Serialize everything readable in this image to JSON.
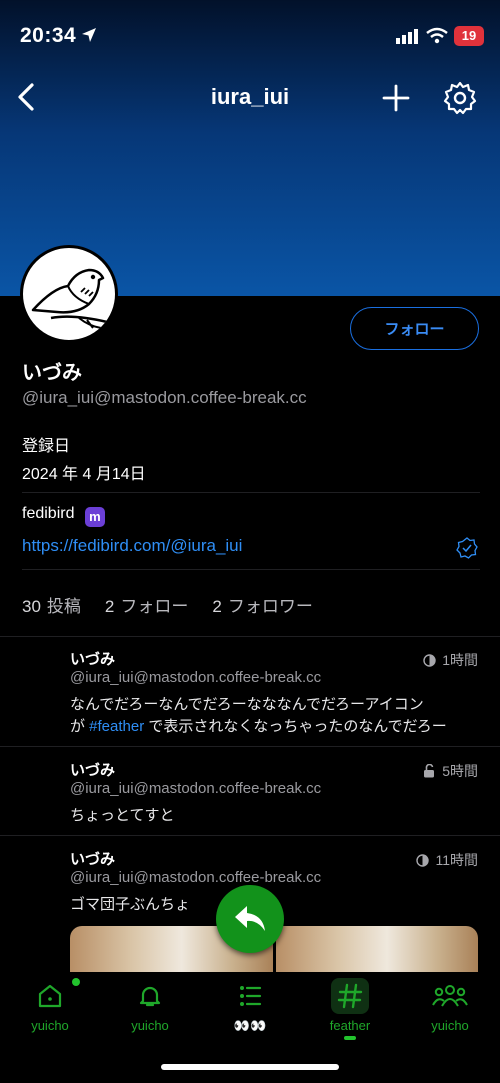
{
  "status_bar": {
    "time": "20:34",
    "battery": "19"
  },
  "nav": {
    "title": "iura_iui"
  },
  "profile": {
    "display_name": "いづみ",
    "acct": "@iura_iui@mastodon.coffee-break.cc",
    "follow_label": "フォロー",
    "joined_label": "登録日",
    "joined_date": "2024 年 4 月14日",
    "field_name": "fedibird",
    "field_badge": "m",
    "field_value": "https://fedibird.com/@iura_iui",
    "stats": [
      {
        "count": "30",
        "label": "投稿"
      },
      {
        "count": "2",
        "label": "フォロー"
      },
      {
        "count": "2",
        "label": "フォロワー"
      }
    ]
  },
  "posts": [
    {
      "name": "いづみ",
      "handle": "@iura_iui@mastodon.coffee-break.cc",
      "visibility_icon": "globe-icon",
      "time": "1時間",
      "text_line1": "なんでだろーなんでだろーなななんでだろーアイコン",
      "text_line2_prefix": "が ",
      "hashtag": "#feather",
      "text_line2_suffix": " で表示されなくなっちゃったのなんでだろー"
    },
    {
      "name": "いづみ",
      "handle": "@iura_iui@mastodon.coffee-break.cc",
      "visibility_icon": "unlock-icon",
      "time": "5時間",
      "text": "ちょっとてすと"
    },
    {
      "name": "いづみ",
      "handle": "@iura_iui@mastodon.coffee-break.cc",
      "visibility_icon": "globe-icon",
      "time": "11時間",
      "text": "ゴマ団子ぶんちょ"
    }
  ],
  "tabs": [
    {
      "icon": "home-icon",
      "label": "yuicho"
    },
    {
      "icon": "bell-icon",
      "label": "yuicho"
    },
    {
      "icon": "list-icon",
      "label": "👀👀"
    },
    {
      "icon": "hashtag-icon",
      "label": "feather",
      "active": true
    },
    {
      "icon": "people-icon",
      "label": "yuicho"
    }
  ],
  "colors": {
    "accent": "#1fa72a",
    "link": "#2f8ef5",
    "fab": "#12921b",
    "banner_top": "#02112a",
    "banner_bottom": "#0a55a6"
  }
}
